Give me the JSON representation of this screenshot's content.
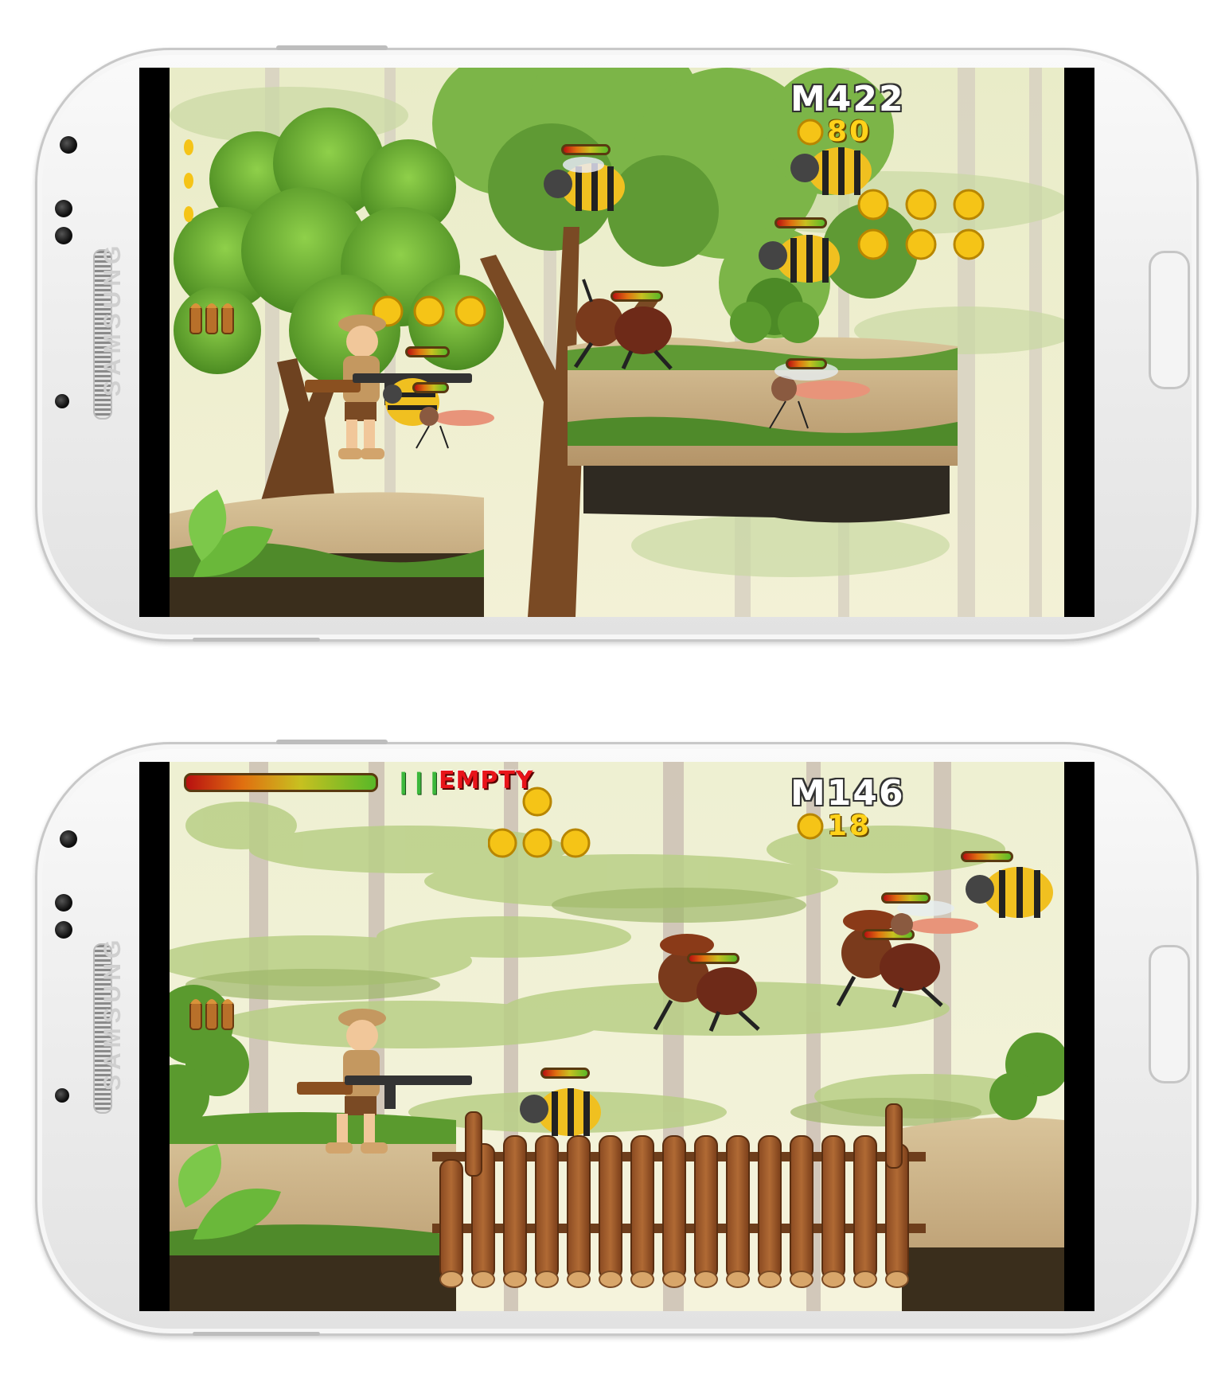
{
  "screenshots": [
    {
      "brand": "SAMSUNG",
      "hud": {
        "distance_label": "M422",
        "coins_count": "80",
        "ammo_state": ""
      }
    },
    {
      "brand": "SAMSUNG",
      "hud": {
        "distance_label": "M146",
        "coins_count": "18",
        "ammo_state": "EMPTY"
      }
    }
  ],
  "colors": {
    "phone_body": "#eeeeee",
    "sky_light": "#f2f0d0",
    "foliage_green": "#5ea32c",
    "trunk_brown": "#7a4a24",
    "coin_gold": "#f5c417",
    "hud_red": "#e8141a",
    "bee_yellow": "#f0c020",
    "ant_brown": "#6e2a18"
  },
  "icons": [
    "coin-icon",
    "bullet-icon",
    "health-bar",
    "soldier-character",
    "wasp-enemy",
    "ant-enemy",
    "mosquito-enemy",
    "wooden-bridge"
  ]
}
